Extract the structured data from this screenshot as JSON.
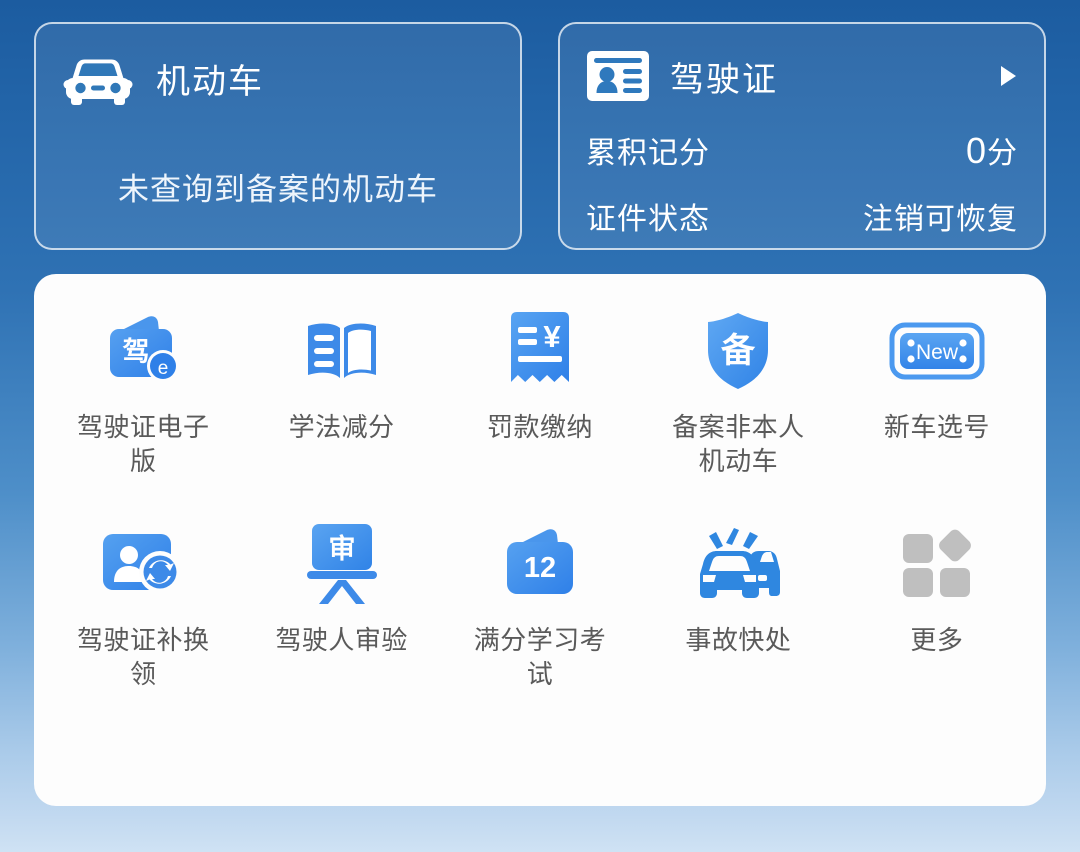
{
  "theme": {
    "bg_top": "#1c5ca0",
    "bg_bottom": "#cfe2f4",
    "accent_blue": "#3d8ae8",
    "panel_bg": "#fdfdfd",
    "label_gray": "#5a5a5a",
    "more_gray": "#b8b8b8"
  },
  "vehicle_card": {
    "icon": "car-icon",
    "title": "机动车",
    "empty_text": "未查询到备案的机动车"
  },
  "license_card": {
    "icon": "id-card-icon",
    "title": "驾驶证",
    "arrow": "chevron-right-icon",
    "rows": [
      {
        "label": "累积记分",
        "value": "0",
        "unit": "分"
      },
      {
        "label": "证件状态",
        "value": "注销可恢复",
        "unit": ""
      }
    ]
  },
  "grid": {
    "rows": [
      [
        {
          "icon": "driver-license-ecard-icon",
          "label": "驾驶证电子版",
          "glyph": "驾",
          "badge": "e"
        },
        {
          "icon": "open-book-icon",
          "label": "学法减分"
        },
        {
          "icon": "receipt-yuan-icon",
          "label": "罚款缴纳",
          "glyph": "¥"
        },
        {
          "icon": "shield-record-icon",
          "label": "备案非本人机动车",
          "glyph": "备"
        },
        {
          "icon": "new-plate-icon",
          "label": "新车选号",
          "glyph": "New"
        }
      ],
      [
        {
          "icon": "license-replace-icon",
          "label": "驾驶证补换领"
        },
        {
          "icon": "driver-review-board-icon",
          "label": "驾驶人审验",
          "glyph": "审"
        },
        {
          "icon": "full-score-exam-icon",
          "label": "满分学习考试",
          "glyph": "12"
        },
        {
          "icon": "accident-cars-icon",
          "label": "事故快处"
        },
        {
          "icon": "more-grid-icon",
          "label": "更多"
        }
      ]
    ]
  }
}
